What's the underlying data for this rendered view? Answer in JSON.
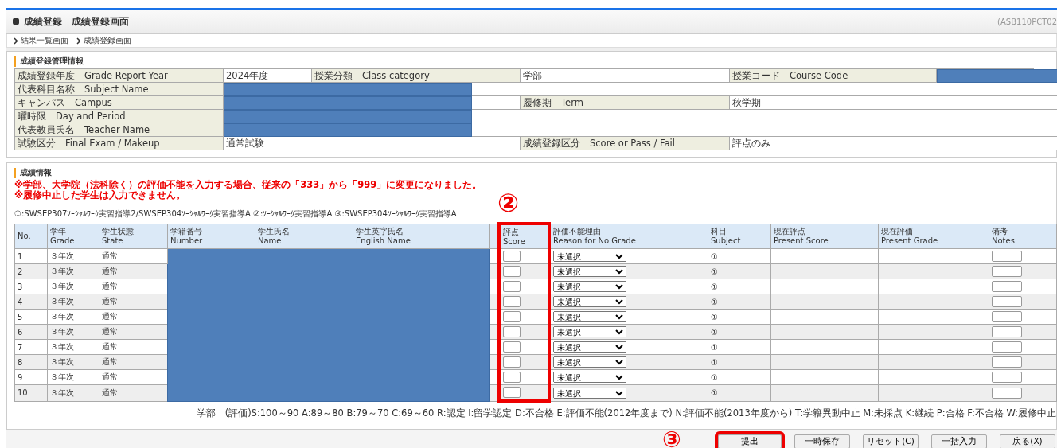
{
  "header": {
    "title": "成績登録　成績登録画面",
    "screen_id": "(ASB110PCT02"
  },
  "breadcrumb": [
    "結果一覧画面",
    "成績登録画面"
  ],
  "management": {
    "title": "成績登録管理情報",
    "rows": [
      [
        {
          "kind": "label",
          "text": "成績登録年度　Grade Report Year"
        },
        {
          "kind": "value",
          "text": "2024年度"
        },
        {
          "kind": "label",
          "text": "授業分類　Class category"
        },
        {
          "kind": "value",
          "text": "学部"
        },
        {
          "kind": "label",
          "text": "授業コード　Course Code"
        },
        {
          "kind": "value",
          "redacted": true
        }
      ],
      [
        {
          "kind": "label",
          "text": "代表科目名称　Subject Name"
        },
        {
          "kind": "value",
          "redacted": true,
          "colspan": 5
        }
      ],
      [
        {
          "kind": "label",
          "text": "キャンパス　Campus"
        },
        {
          "kind": "value",
          "redacted": true,
          "colspan": 2
        },
        {
          "kind": "label",
          "text": "履修期　Term"
        },
        {
          "kind": "value",
          "text": "秋学期",
          "colspan": 2
        }
      ],
      [
        {
          "kind": "label",
          "text": "曜時限　Day and Period"
        },
        {
          "kind": "value",
          "redacted": true,
          "colspan": 5
        }
      ],
      [
        {
          "kind": "label",
          "text": "代表教員氏名　Teacher Name"
        },
        {
          "kind": "value",
          "redacted": true,
          "colspan": 5
        }
      ],
      [
        {
          "kind": "label",
          "text": "試験区分　Final Exam / Makeup"
        },
        {
          "kind": "value",
          "text": "通常試験",
          "colspan": 2
        },
        {
          "kind": "label",
          "text": "成績登録区分　Score or Pass / Fail"
        },
        {
          "kind": "value",
          "text": "評点のみ",
          "colspan": 2
        }
      ]
    ]
  },
  "grades": {
    "title": "成績情報",
    "notices": [
      "※学部、大学院（法科除く）の評価不能を入力する場合、従来の「333」から「999」に変更になりました。",
      "※履修中止した学生は入力できません。"
    ],
    "redacted": true,
    "subject_legend": "①:SWSEP307ｿｰｼｬﾙﾜｰｸ実習指導2/SWSEP304ｿｰｼｬﾙﾜｰｸ実習指導A ②:ｿｰｼｬﾙﾜｰｸ実習指導A ③:SWSEP304ｿｰｼｬﾙﾜｰｸ実習指導A",
    "columns": [
      {
        "kind": "no",
        "ja": "No."
      },
      {
        "kind": "grade",
        "ja": "学年",
        "en": "Grade"
      },
      {
        "kind": "state",
        "ja": "学生状態",
        "en": "State"
      },
      {
        "kind": "number",
        "ja": "学籍番号",
        "en": "Number"
      },
      {
        "kind": "name",
        "ja": "学生氏名",
        "en": "Name"
      },
      {
        "kind": "english",
        "ja": "学生英字氏名",
        "en": "English Name"
      },
      {
        "kind": "blank"
      },
      {
        "kind": "score",
        "ja": "評点",
        "en": "Score",
        "highlighted": true,
        "callout": "②"
      },
      {
        "kind": "reason",
        "ja": "評価不能理由",
        "en": "Reason for No Grade"
      },
      {
        "kind": "subject",
        "ja": "科目",
        "en": "Subject"
      },
      {
        "kind": "present_score",
        "ja": "現在評点",
        "en": "Present Score"
      },
      {
        "kind": "present_grade",
        "ja": "現在評価",
        "en": "Present Grade"
      },
      {
        "kind": "notes",
        "ja": "備考",
        "en": "Notes"
      }
    ],
    "rows": [
      {
        "no": "1",
        "grade": "３年次",
        "state": "通常",
        "reason": "未選択",
        "subject": "①"
      },
      {
        "no": "2",
        "grade": "３年次",
        "state": "通常",
        "reason": "未選択",
        "subject": "①"
      },
      {
        "no": "3",
        "grade": "３年次",
        "state": "通常",
        "reason": "未選択",
        "subject": "①"
      },
      {
        "no": "4",
        "grade": "３年次",
        "state": "通常",
        "reason": "未選択",
        "subject": "①"
      },
      {
        "no": "5",
        "grade": "３年次",
        "state": "通常",
        "reason": "未選択",
        "subject": "①"
      },
      {
        "no": "6",
        "grade": "３年次",
        "state": "通常",
        "reason": "未選択",
        "subject": "①"
      },
      {
        "no": "7",
        "grade": "３年次",
        "state": "通常",
        "reason": "未選択",
        "subject": "①"
      },
      {
        "no": "8",
        "grade": "３年次",
        "state": "通常",
        "reason": "未選択",
        "subject": "①"
      },
      {
        "no": "9",
        "grade": "３年次",
        "state": "通常",
        "reason": "未選択",
        "subject": "①"
      },
      {
        "no": "10",
        "grade": "３年次",
        "state": "通常",
        "reason": "未選択",
        "subject": "①"
      }
    ],
    "grade_legend": "学部　(評価)S:100～90 A:89～80 B:79～70 C:69～60 R:認定 I:留学認定 D:不合格 E:評価不能(2012年度まで) N:評価不能(2013年度から) T:学籍異動中止 M:未採点 K:継続 P:合格 F:不合格 W:履修中止"
  },
  "buttons": [
    {
      "label": "提出",
      "highlighted": true,
      "callout": "③"
    },
    {
      "label": "一時保存",
      "highlighted": false
    },
    {
      "label": "リセット(C)",
      "highlighted": false
    },
    {
      "label": "一括入力",
      "highlighted": false
    },
    {
      "label": "戻る(X)",
      "highlighted": false
    }
  ]
}
